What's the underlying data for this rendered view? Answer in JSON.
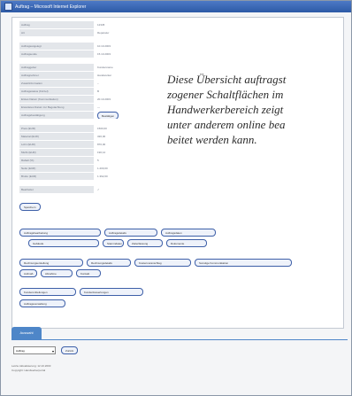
{
  "window": {
    "title": "Auftrag – Microsoft Internet Explorer"
  },
  "fields": [
    {
      "label": "Auftrag",
      "value": "12345"
    },
    {
      "label": "Art",
      "value": "Reparatur"
    },
    {
      "label": "Auftragsangelegt",
      "value": "10.10.2003"
    },
    {
      "label": "Auftragsende",
      "value": "15.10.2003"
    },
    {
      "label": "Auftraggeber",
      "value": "Kundenname"
    },
    {
      "label": "Auftragnehmer",
      "value": "Handwerker"
    },
    {
      "label": "Zusatzinformation",
      "value": "–"
    },
    {
      "label": "Auftragsstatus (Kürzel)",
      "value": "B"
    },
    {
      "label": "Erstes Datum (Kommunikation)",
      "value": "20.10.2003"
    },
    {
      "label": "Erwartetes Datum zur Begutachtung",
      "value": "—"
    },
    {
      "label": "Auftragsbestätigung",
      "value": ""
    },
    {
      "label": "Preis (EUR)",
      "value": "1500,00"
    },
    {
      "label": "Material (EUR)",
      "value": "320,00"
    },
    {
      "label": "Lohn (EUR)",
      "value": "870,00"
    },
    {
      "label": "MwSt (EUR)",
      "value": "190,12"
    },
    {
      "label": "Rabatt (%)",
      "value": "5"
    },
    {
      "label": "Netto (EUR)",
      "value": "1.200,00"
    },
    {
      "label": "Brutto (EUR)",
      "value": "1.392,00"
    },
    {
      "label": "Bearbeitet",
      "value": "✓"
    }
  ],
  "buttons": {
    "confirm": "Bestätigen",
    "speichern": "Speichern",
    "row1": [
      "Auftragsbearbeitung",
      "Auftragsdetails",
      "Auftragsdaten"
    ],
    "row2": [
      "Gebäude",
      "Stammdaten",
      "Zeiterfassung",
      "Dokumente"
    ],
    "row3": [
      "Rechnungserstellung",
      "Rechnungsdetails",
      "Kostenvoranschlag",
      "Sonstige Kommunikation"
    ],
    "row4": [
      "Aufmaß",
      "Abnahme",
      "Kontakt"
    ],
    "row5": [
      "Kundenmitteilungen",
      "Kundenbewertungen"
    ],
    "row6": [
      "Auftragsverwaltung"
    ]
  },
  "overlay_text": [
    "Diese Übersicht auftragst",
    "zogener Schaltflächen im",
    "Handwerkerbereich zeigt",
    "unter anderem online bea",
    "beitet werden kann."
  ],
  "lower": {
    "tab_label": "Auswahl",
    "select_value": "Auftrag",
    "go_button": "Zurück",
    "footer": [
      "Letzte Aktualisierung: 12.10.2003",
      "Copyright: Handwerkerportal"
    ]
  }
}
